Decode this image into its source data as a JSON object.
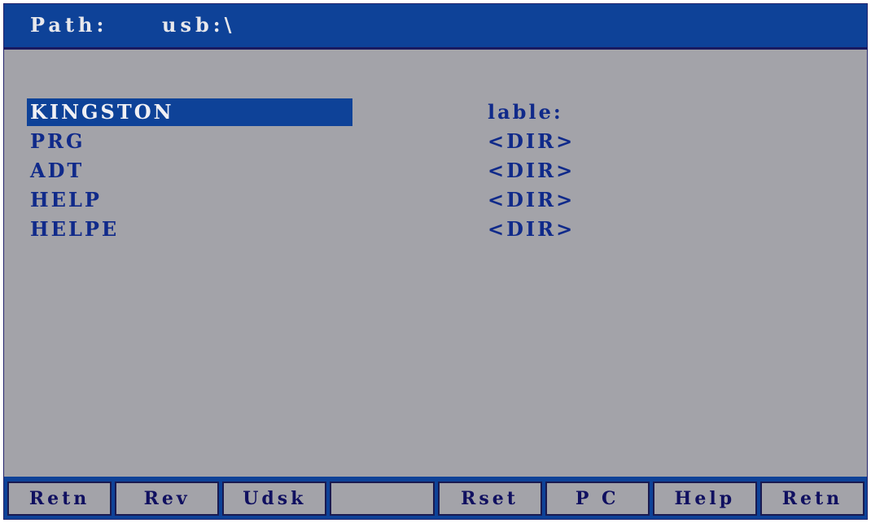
{
  "header": {
    "path_label": "Path:",
    "path_value": "usb:\\"
  },
  "files": [
    {
      "name": "KINGSTON",
      "attr": "lable:",
      "selected": true
    },
    {
      "name": "PRG",
      "attr": "<DIR>",
      "selected": false
    },
    {
      "name": "ADT",
      "attr": "<DIR>",
      "selected": false
    },
    {
      "name": "HELP",
      "attr": "<DIR>",
      "selected": false
    },
    {
      "name": "HELPE",
      "attr": "<DIR>",
      "selected": false
    }
  ],
  "softkeys": [
    "Retn",
    "Rev",
    "Udsk",
    "",
    "Rset",
    "P C",
    "Help",
    "Retn"
  ],
  "colors": {
    "header_bg": "#0e4298",
    "screen_bg": "#a3a3a9",
    "text": "#102a8a",
    "selection_bg": "#0e4298"
  }
}
